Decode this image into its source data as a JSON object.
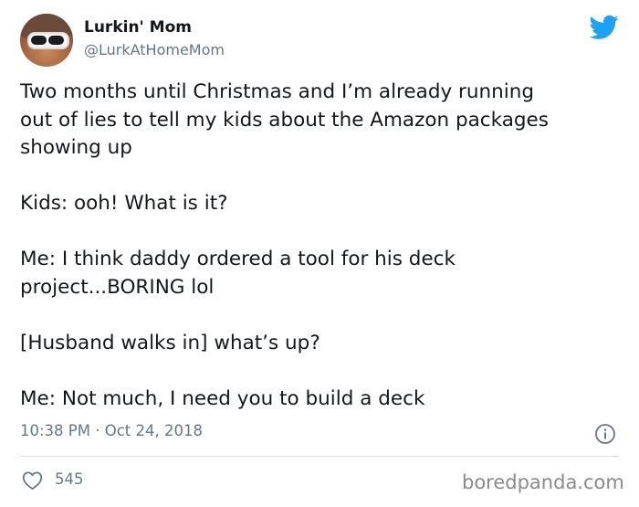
{
  "author": {
    "name": "Lurkin' Mom",
    "handle": "@LurkAtHomeMom"
  },
  "tweet": {
    "paragraphs": [
      "Two months until Christmas and I’m already running\nout of lies to tell my kids about the Amazon packages\nshowing up",
      "Kids: ooh! What is it?",
      "Me: I think daddy ordered a tool for his deck\nproject...BORING lol",
      "[Husband walks in] what’s up?",
      "Me: Not much, I need you to build a deck"
    ],
    "timestamp": "10:38 PM · Oct 24, 2018",
    "likes": "545"
  },
  "watermark": "boredpanda.com",
  "icons": {
    "brand": "twitter-bird-icon",
    "info": "info-icon",
    "like": "heart-icon"
  },
  "colors": {
    "twitter_blue": "#1da1f2",
    "secondary_text": "#657786",
    "primary_text": "#14171a"
  }
}
